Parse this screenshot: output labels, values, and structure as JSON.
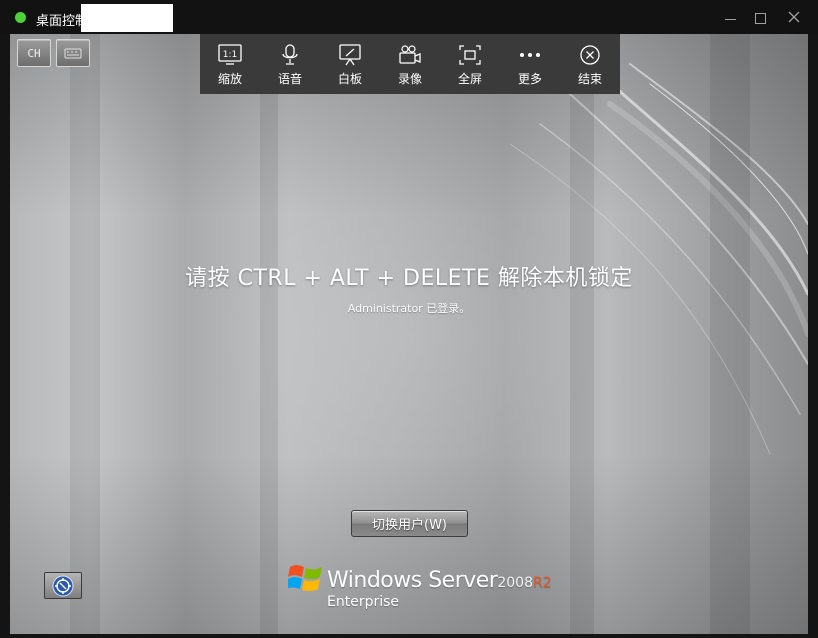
{
  "window": {
    "title": "桌面控制",
    "status_color": "#4fd13a"
  },
  "remote": {
    "mini_buttons": {
      "lang": "CH"
    },
    "toolbar": {
      "items": [
        {
          "label": "缩放",
          "icon": "zoom-1to1-icon"
        },
        {
          "label": "语音",
          "icon": "microphone-icon"
        },
        {
          "label": "白板",
          "icon": "whiteboard-icon"
        },
        {
          "label": "录像",
          "icon": "video-camera-icon"
        },
        {
          "label": "全屏",
          "icon": "fullscreen-icon"
        },
        {
          "label": "更多",
          "icon": "more-dots-icon"
        },
        {
          "label": "结束",
          "icon": "close-circle-icon"
        }
      ],
      "zoom_glyph": "1:1"
    },
    "lock": {
      "message": "请按 CTRL + ALT + DELETE 解除本机锁定",
      "sub": "Administrator 已登录。",
      "switch_user": "切换用户(W)"
    },
    "brand": {
      "name": "Windows Server",
      "version": "2008",
      "version_suffix": "R2",
      "edition": "Enterprise",
      "suffix_color": "#e8562a"
    }
  }
}
